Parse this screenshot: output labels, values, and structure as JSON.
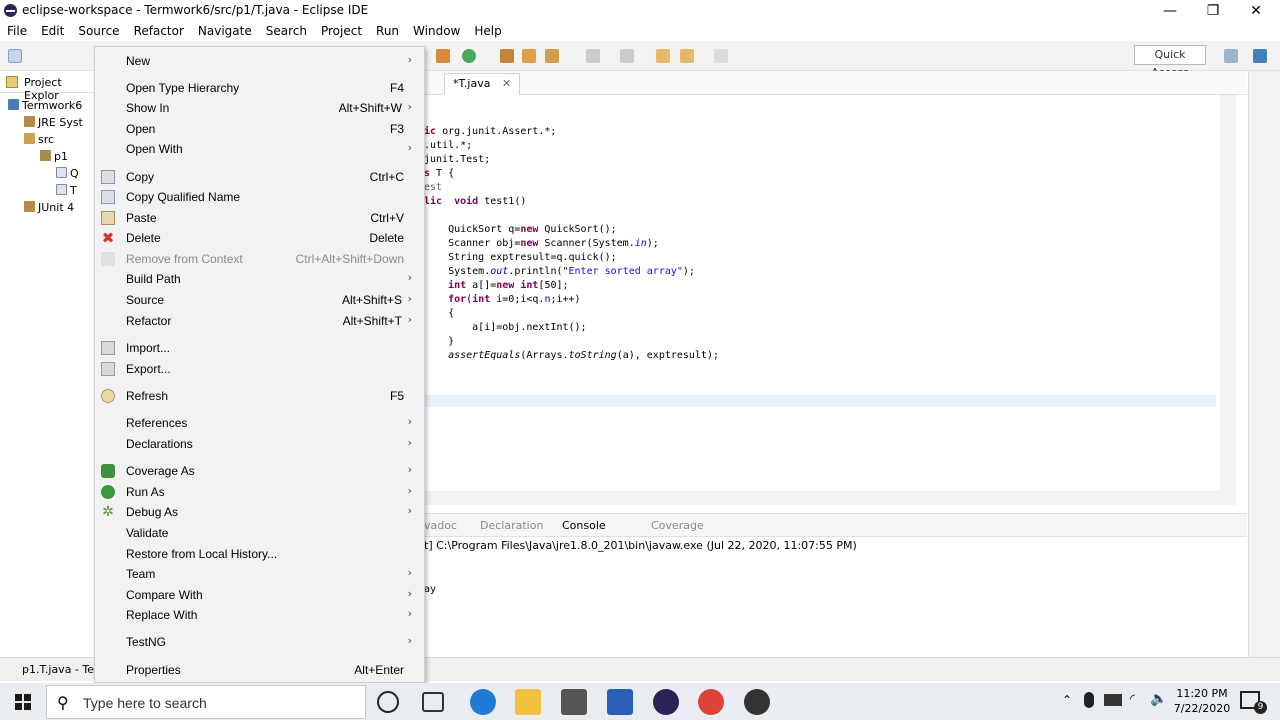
{
  "window": {
    "title": "eclipse-workspace - Termwork6/src/p1/T.java - Eclipse IDE",
    "minimize": "—",
    "maximize": "❐",
    "close": "✕"
  },
  "menubar": [
    "File",
    "Edit",
    "Source",
    "Refactor",
    "Navigate",
    "Search",
    "Project",
    "Run",
    "Window",
    "Help"
  ],
  "toolbar": {
    "quick_access": "Quick Access"
  },
  "explorer": {
    "tab_label": "Project Explor",
    "items": [
      "Termwork6",
      "JRE Syst",
      "src",
      "p1",
      "Q",
      "T",
      "JUnit 4"
    ]
  },
  "editor": {
    "tab_label": "*T.java",
    "lines": [
      [
        "",
        "ic",
        " org.junit.Assert.*;"
      ],
      [
        "",
        "",
        ".util.*;"
      ],
      [
        "",
        "",
        "junit.Test;"
      ],
      [
        "s",
        "",
        " T {"
      ],
      [
        "",
        "",
        "est"
      ],
      [
        "lic",
        "",
        "  void test1()"
      ],
      [
        "",
        "",
        ""
      ],
      [
        "",
        "",
        "    QuickSort q=new QuickSort();"
      ],
      [
        "",
        "",
        "    Scanner obj=new Scanner(System.in);"
      ],
      [
        "",
        "",
        "    String exptresult=q.quick();"
      ],
      [
        "",
        "",
        "    System.out.println(\"Enter sorted array\");"
      ],
      [
        "",
        "",
        "    int a[]=new int[50];"
      ],
      [
        "",
        "",
        "    for(int i=0;i<q.n;i++)"
      ],
      [
        "",
        "",
        "    {"
      ],
      [
        "",
        "",
        "        a[i]=obj.nextInt();"
      ],
      [
        "",
        "",
        "    }"
      ],
      [
        "",
        "",
        "    assertEquals(Arrays.toString(a), exptresult);"
      ]
    ]
  },
  "console": {
    "tabs": [
      "vadoc",
      "Declaration",
      "Console",
      "Coverage"
    ],
    "header": "t] C:\\Program Files\\Java\\jre1.8.0_201\\bin\\javaw.exe (Jul 22, 2020, 11:07:55 PM)",
    "body": "ay"
  },
  "statusbar": {
    "text": "p1.T.java - Ter"
  },
  "context_menu": {
    "items": [
      {
        "label": "New",
        "shortcut": "",
        "submenu": true,
        "icon": ""
      },
      {
        "label": "Open Type Hierarchy",
        "shortcut": "F4",
        "submenu": false,
        "icon": ""
      },
      {
        "label": "Show In",
        "shortcut": "Alt+Shift+W",
        "submenu": true,
        "icon": ""
      },
      {
        "label": "Open",
        "shortcut": "F3",
        "submenu": false,
        "icon": ""
      },
      {
        "label": "Open With",
        "shortcut": "",
        "submenu": true,
        "icon": ""
      },
      {
        "label": "Copy",
        "shortcut": "Ctrl+C",
        "submenu": false,
        "icon": "copy-icon"
      },
      {
        "label": "Copy Qualified Name",
        "shortcut": "",
        "submenu": false,
        "icon": "copy-qualified-icon"
      },
      {
        "label": "Paste",
        "shortcut": "Ctrl+V",
        "submenu": false,
        "icon": "paste-icon"
      },
      {
        "label": "Delete",
        "shortcut": "Delete",
        "submenu": false,
        "icon": "delete-icon"
      },
      {
        "label": "Remove from Context",
        "shortcut": "Ctrl+Alt+Shift+Down",
        "submenu": false,
        "icon": "remove-context-icon",
        "disabled": true
      },
      {
        "label": "Build Path",
        "shortcut": "",
        "submenu": true,
        "icon": ""
      },
      {
        "label": "Source",
        "shortcut": "Alt+Shift+S",
        "submenu": true,
        "icon": ""
      },
      {
        "label": "Refactor",
        "shortcut": "Alt+Shift+T",
        "submenu": true,
        "icon": ""
      },
      {
        "label": "Import...",
        "shortcut": "",
        "submenu": false,
        "icon": "import-icon"
      },
      {
        "label": "Export...",
        "shortcut": "",
        "submenu": false,
        "icon": "export-icon"
      },
      {
        "label": "Refresh",
        "shortcut": "F5",
        "submenu": false,
        "icon": "refresh-icon"
      },
      {
        "label": "References",
        "shortcut": "",
        "submenu": true,
        "icon": ""
      },
      {
        "label": "Declarations",
        "shortcut": "",
        "submenu": true,
        "icon": ""
      },
      {
        "label": "Coverage As",
        "shortcut": "",
        "submenu": true,
        "icon": "coverage-icon"
      },
      {
        "label": "Run As",
        "shortcut": "",
        "submenu": true,
        "icon": "run-icon"
      },
      {
        "label": "Debug As",
        "shortcut": "",
        "submenu": true,
        "icon": "debug-icon"
      },
      {
        "label": "Validate",
        "shortcut": "",
        "submenu": false,
        "icon": ""
      },
      {
        "label": "Restore from Local History...",
        "shortcut": "",
        "submenu": false,
        "icon": ""
      },
      {
        "label": "Team",
        "shortcut": "",
        "submenu": true,
        "icon": ""
      },
      {
        "label": "Compare With",
        "shortcut": "",
        "submenu": true,
        "icon": ""
      },
      {
        "label": "Replace With",
        "shortcut": "",
        "submenu": true,
        "icon": ""
      },
      {
        "label": "TestNG",
        "shortcut": "",
        "submenu": true,
        "icon": ""
      },
      {
        "label": "Properties",
        "shortcut": "Alt+Enter",
        "submenu": false,
        "icon": ""
      }
    ]
  },
  "taskbar": {
    "search_placeholder": "Type here to search",
    "time": "11:20 PM",
    "date": "7/22/2020",
    "notification_count": "9"
  },
  "colors": {
    "menu_bg": "#f2f2f2",
    "keyword": "#7f0055",
    "string": "#2a00ff",
    "field": "#0000c0",
    "taskbar_bg": "#e9ecf1"
  }
}
